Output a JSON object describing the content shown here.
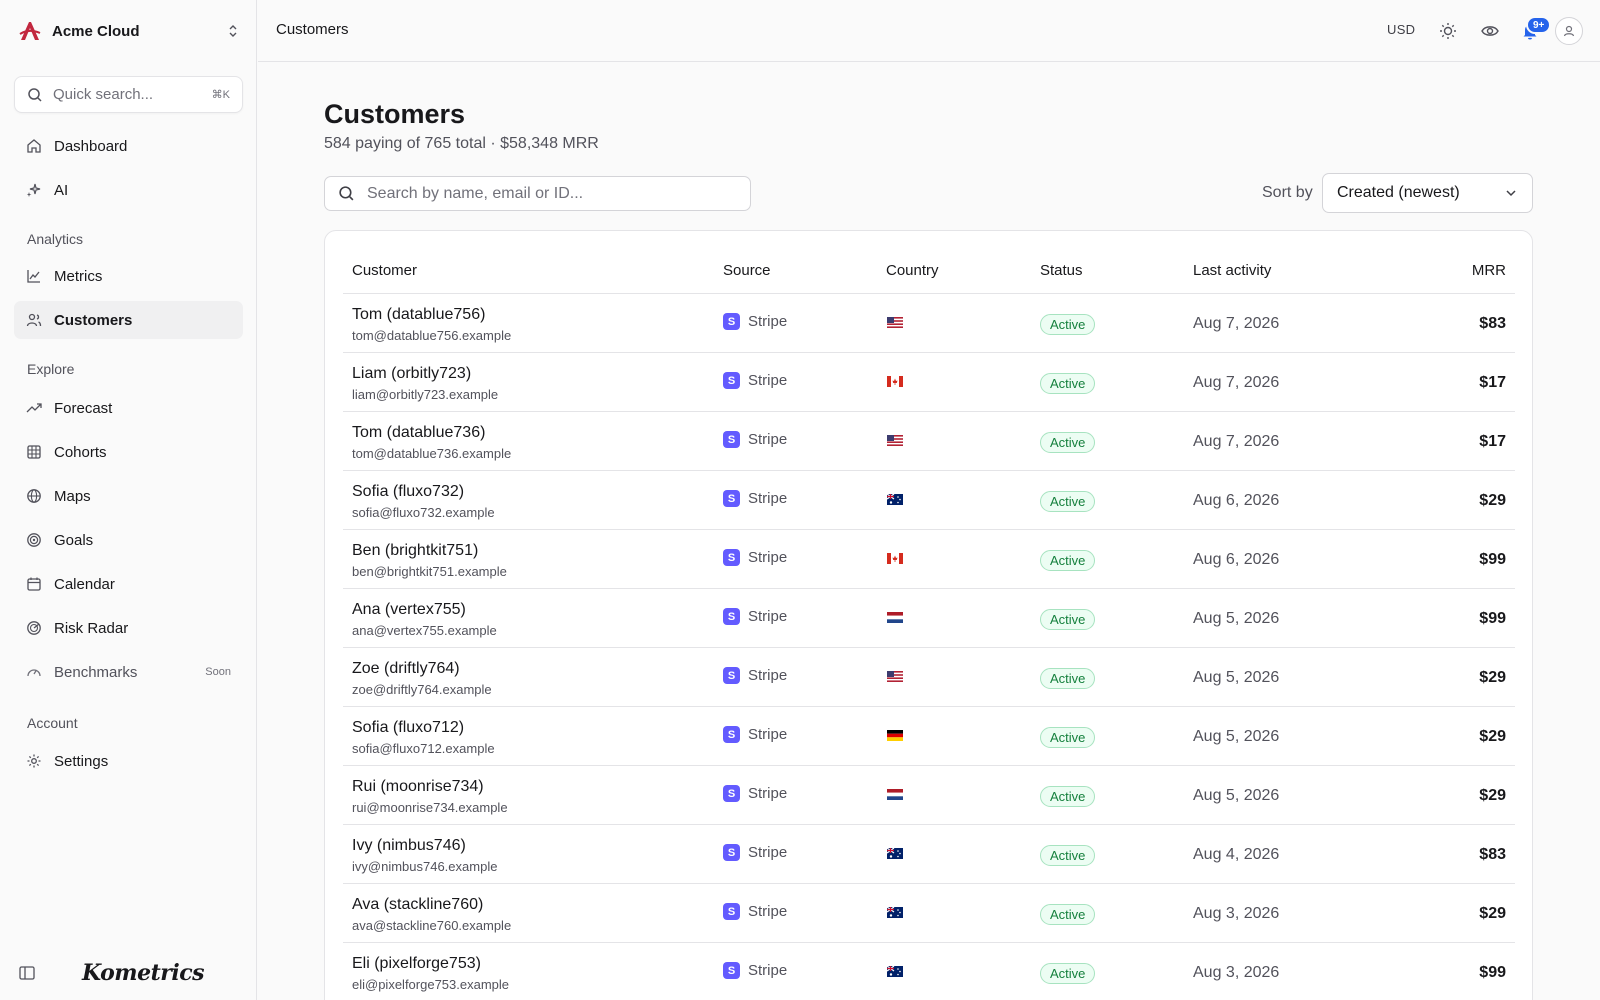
{
  "app": {
    "workspace_name": "Acme Cloud",
    "brand": "Kometrics",
    "quick_search_placeholder": "Quick search...",
    "quick_search_shortcut": "⌘K"
  },
  "sidebar": {
    "primary": [
      {
        "label": "Dashboard",
        "icon": "home-icon"
      },
      {
        "label": "AI",
        "icon": "sparkles-icon"
      }
    ],
    "sections": {
      "analytics": "Analytics",
      "explore": "Explore",
      "account": "Account"
    },
    "analytics_items": [
      {
        "label": "Metrics",
        "icon": "line-chart-icon"
      },
      {
        "label": "Customers",
        "icon": "users-icon",
        "active": true
      }
    ],
    "explore_items": [
      {
        "label": "Forecast",
        "icon": "trending-up-icon"
      },
      {
        "label": "Cohorts",
        "icon": "grid-icon"
      },
      {
        "label": "Maps",
        "icon": "globe-icon"
      },
      {
        "label": "Goals",
        "icon": "target-icon"
      },
      {
        "label": "Calendar",
        "icon": "calendar-icon"
      },
      {
        "label": "Risk Radar",
        "icon": "radar-icon"
      },
      {
        "label": "Benchmarks",
        "icon": "gauge-icon",
        "tag": "Soon"
      }
    ],
    "account_items": [
      {
        "label": "Settings",
        "icon": "gear-icon"
      }
    ]
  },
  "topbar": {
    "breadcrumb": "Customers",
    "currency": "USD",
    "notifications_badge": "9+"
  },
  "page": {
    "title": "Customers",
    "subtitle": "584 paying of 765 total · $58,348 MRR",
    "search_placeholder": "Search by name, email or ID...",
    "sort_label": "Sort by",
    "sort_value": "Created (newest)"
  },
  "table": {
    "columns": [
      "Customer",
      "Source",
      "Country",
      "Status",
      "Last activity",
      "MRR"
    ],
    "rows": [
      {
        "name": "Tom (datablue756)",
        "email": "tom@datablue756.example",
        "source": "Stripe",
        "country": "US",
        "status": "Active",
        "last": "Aug 7, 2026",
        "mrr": "$83"
      },
      {
        "name": "Liam (orbitly723)",
        "email": "liam@orbitly723.example",
        "source": "Stripe",
        "country": "CA",
        "status": "Active",
        "last": "Aug 7, 2026",
        "mrr": "$17"
      },
      {
        "name": "Tom (datablue736)",
        "email": "tom@datablue736.example",
        "source": "Stripe",
        "country": "US",
        "status": "Active",
        "last": "Aug 7, 2026",
        "mrr": "$17"
      },
      {
        "name": "Sofia (fluxo732)",
        "email": "sofia@fluxo732.example",
        "source": "Stripe",
        "country": "AU",
        "status": "Active",
        "last": "Aug 6, 2026",
        "mrr": "$29"
      },
      {
        "name": "Ben (brightkit751)",
        "email": "ben@brightkit751.example",
        "source": "Stripe",
        "country": "CA",
        "status": "Active",
        "last": "Aug 6, 2026",
        "mrr": "$99"
      },
      {
        "name": "Ana (vertex755)",
        "email": "ana@vertex755.example",
        "source": "Stripe",
        "country": "NL",
        "status": "Active",
        "last": "Aug 5, 2026",
        "mrr": "$99"
      },
      {
        "name": "Zoe (driftly764)",
        "email": "zoe@driftly764.example",
        "source": "Stripe",
        "country": "US",
        "status": "Active",
        "last": "Aug 5, 2026",
        "mrr": "$29"
      },
      {
        "name": "Sofia (fluxo712)",
        "email": "sofia@fluxo712.example",
        "source": "Stripe",
        "country": "DE",
        "status": "Active",
        "last": "Aug 5, 2026",
        "mrr": "$29"
      },
      {
        "name": "Rui (moonrise734)",
        "email": "rui@moonrise734.example",
        "source": "Stripe",
        "country": "NL",
        "status": "Active",
        "last": "Aug 5, 2026",
        "mrr": "$29"
      },
      {
        "name": "Ivy (nimbus746)",
        "email": "ivy@nimbus746.example",
        "source": "Stripe",
        "country": "AU",
        "status": "Active",
        "last": "Aug 4, 2026",
        "mrr": "$83"
      },
      {
        "name": "Ava (stackline760)",
        "email": "ava@stackline760.example",
        "source": "Stripe",
        "country": "AU",
        "status": "Active",
        "last": "Aug 3, 2026",
        "mrr": "$29"
      },
      {
        "name": "Eli (pixelforge753)",
        "email": "eli@pixelforge753.example",
        "source": "Stripe",
        "country": "AU",
        "status": "Active",
        "last": "Aug 3, 2026",
        "mrr": "$99"
      }
    ]
  },
  "colors": {
    "accent": "#2563eb",
    "stripe": "#635bff",
    "active_bg": "#ecfdf3",
    "active_text": "#15803d",
    "logo_red": "#c2273e"
  }
}
